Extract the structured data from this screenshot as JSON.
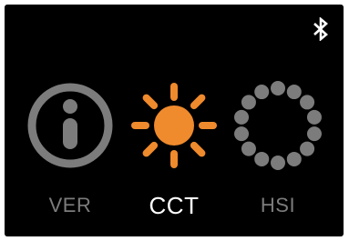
{
  "status": {
    "icon": "bluetooth-icon",
    "color": "#ffffff"
  },
  "modes": [
    {
      "id": "ver",
      "label": "VER",
      "icon": "info-icon",
      "active": false,
      "color": "#7c7c7c"
    },
    {
      "id": "cct",
      "label": "CCT",
      "icon": "sun-icon",
      "active": true,
      "color": "#ef8a2d"
    },
    {
      "id": "hsi",
      "label": "HSI",
      "icon": "dotted-circle-icon",
      "active": false,
      "color": "#7c7c7c"
    }
  ],
  "theme": {
    "background": "#000000",
    "label_inactive": "#7c7c7c",
    "label_active": "#ffffff",
    "accent": "#ef8a2d"
  }
}
